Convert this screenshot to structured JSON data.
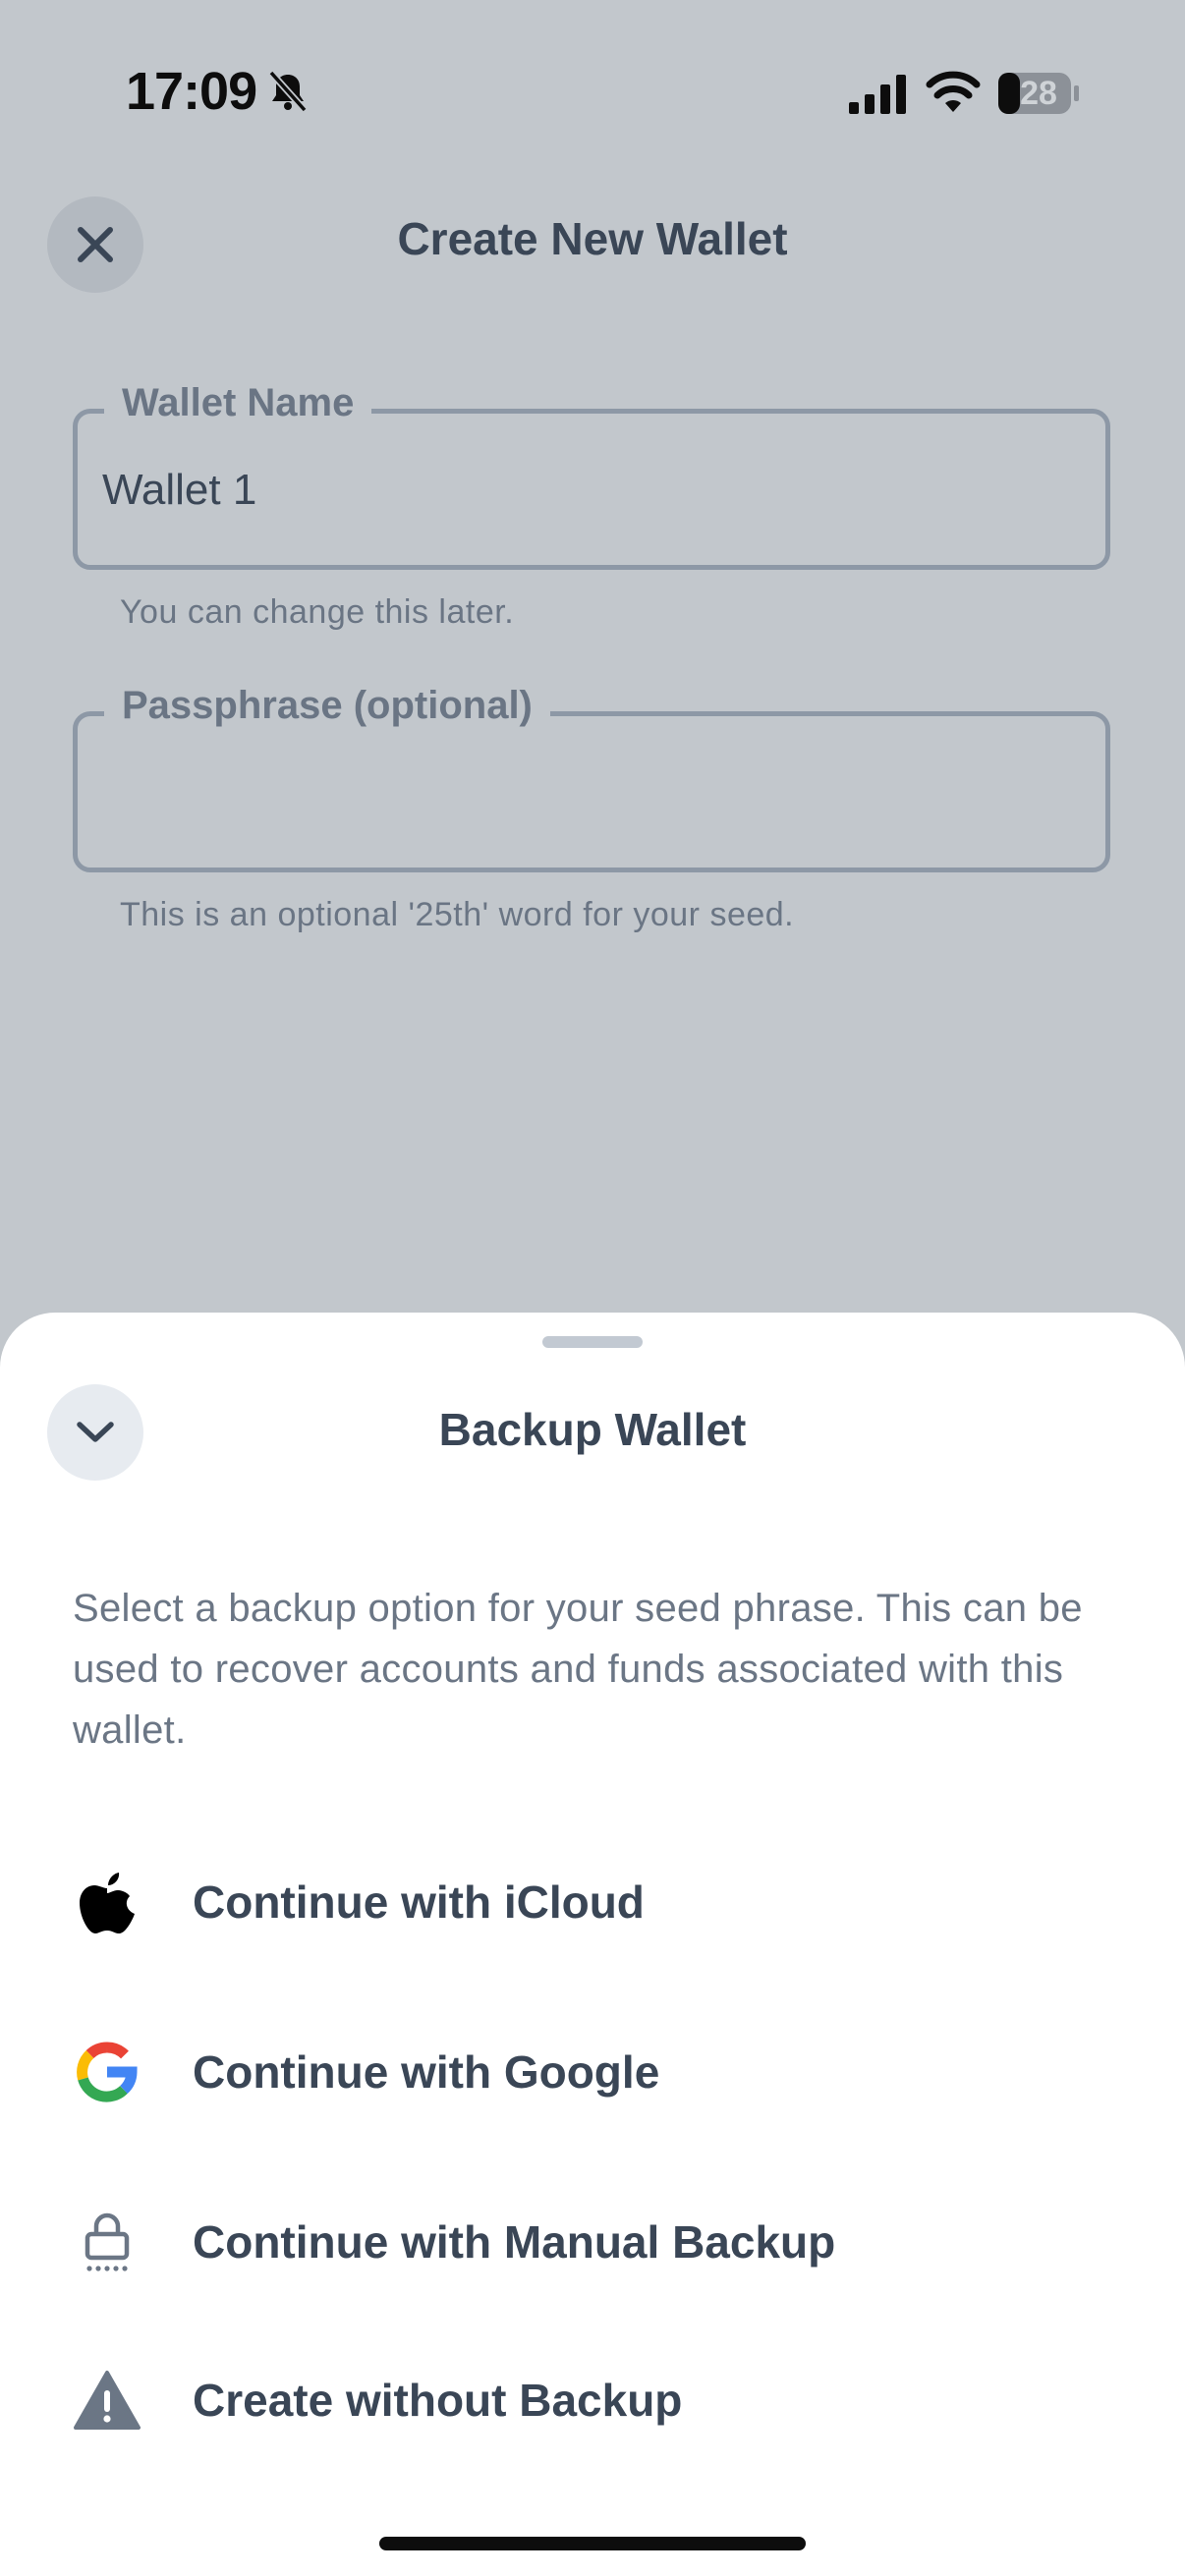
{
  "status_bar": {
    "time": "17:09",
    "battery": "28",
    "icons": [
      "bell-slash-icon",
      "cellular-signal-icon",
      "wifi-icon",
      "battery-icon"
    ]
  },
  "header": {
    "title": "Create New Wallet",
    "close_icon": "close-icon"
  },
  "form": {
    "wallet_name": {
      "label": "Wallet Name",
      "value": "Wallet 1",
      "helper": "You can change this later."
    },
    "passphrase": {
      "label": "Passphrase (optional)",
      "value": "",
      "helper": "This is an optional '25th' word for your seed."
    }
  },
  "sheet": {
    "title": "Backup Wallet",
    "collapse_icon": "chevron-down-icon",
    "description": "Select a backup option for your seed phrase. This can be used to recover accounts and funds associated with this wallet.",
    "options": [
      {
        "label": "Continue with iCloud",
        "icon": "apple-icon"
      },
      {
        "label": "Continue with Google",
        "icon": "google-icon"
      },
      {
        "label": "Continue with Manual Backup",
        "icon": "lock-icon"
      },
      {
        "label": "Create without Backup",
        "icon": "warning-icon"
      }
    ]
  },
  "colors": {
    "overlay_background": "#c2c7cc",
    "text_primary": "#3a4656",
    "text_secondary": "#6b7685",
    "sheet_background": "#ffffff"
  }
}
